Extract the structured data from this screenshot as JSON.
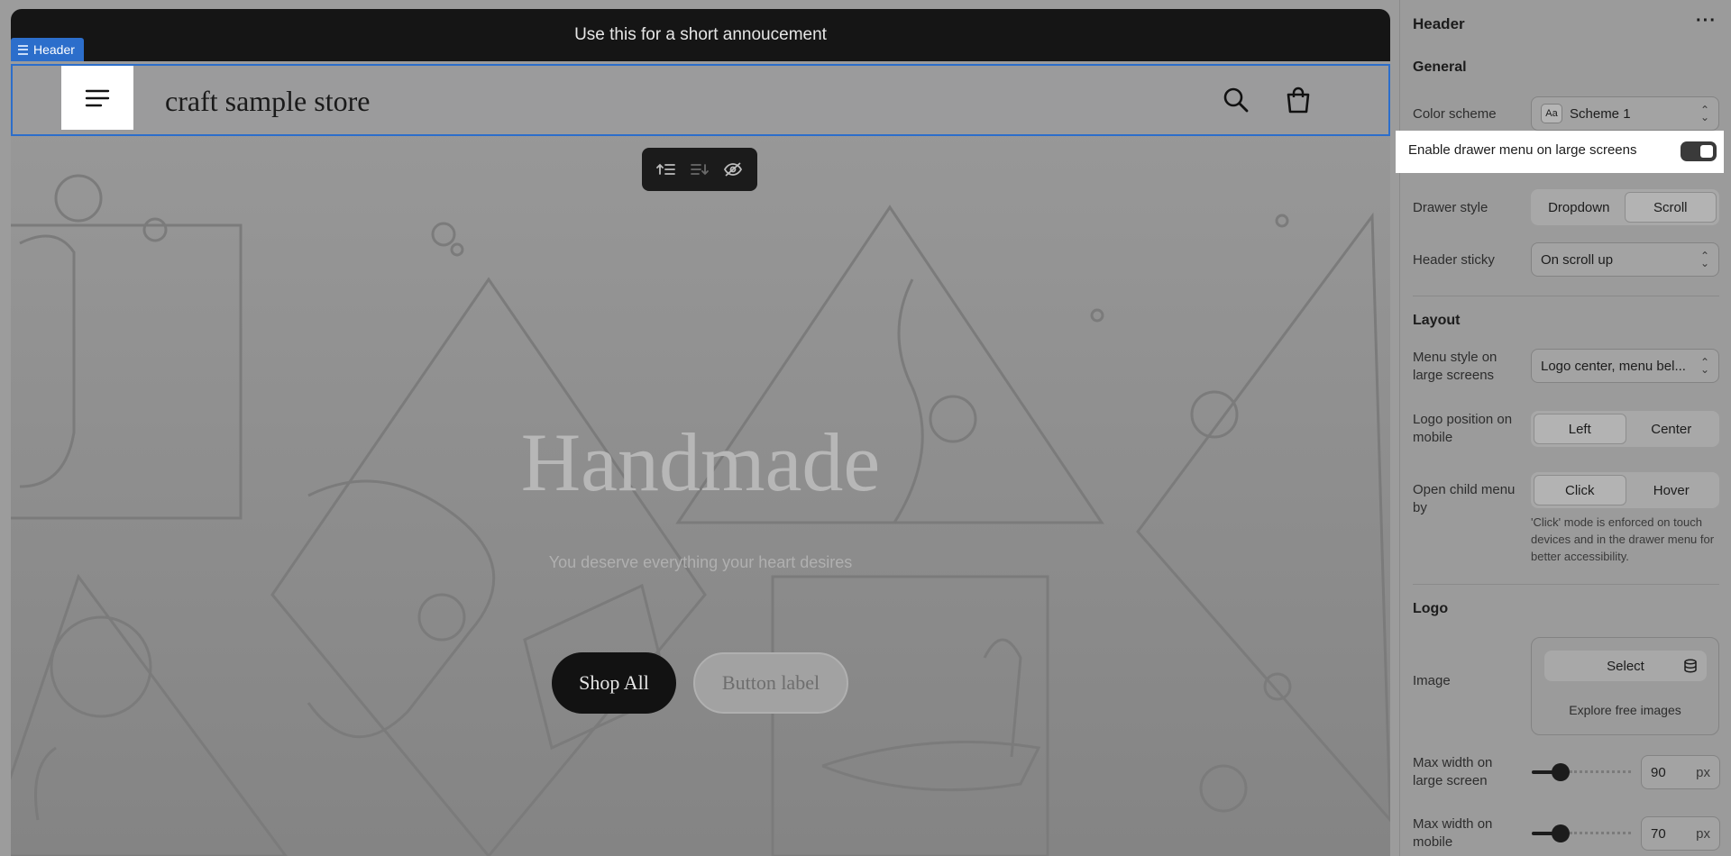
{
  "preview": {
    "announcement": "Use this for a short annoucement",
    "header_tag": "Header",
    "store_name": "craft sample store",
    "icons": {
      "menu": "hamburger-menu-icon",
      "search": "search-icon",
      "cart": "shopping-bag-icon"
    },
    "toolbar": {
      "move_up": "move-up-icon",
      "move_down": "move-down-icon",
      "hide": "hide-eye-icon"
    },
    "hero": {
      "heading": "Handmade",
      "subheading": "You deserve everything your heart desires",
      "primary_button": "Shop All",
      "secondary_button": "Button label"
    }
  },
  "panel": {
    "title": "Header",
    "more": "···",
    "general": {
      "title": "General",
      "color_scheme_label": "Color scheme",
      "color_scheme_value": "Scheme 1",
      "color_scheme_swatch": "Aa",
      "drawer_toggle_label": "Enable drawer menu on large screens",
      "drawer_toggle_on": true,
      "drawer_style_label": "Drawer style",
      "drawer_style_options": [
        "Dropdown",
        "Scroll"
      ],
      "drawer_style_selected": "Scroll",
      "header_sticky_label": "Header sticky",
      "header_sticky_value": "On scroll up"
    },
    "layout": {
      "title": "Layout",
      "menu_style_label": "Menu style on large screens",
      "menu_style_value": "Logo center, menu bel...",
      "logo_position_label": "Logo position on mobile",
      "logo_position_options": [
        "Left",
        "Center"
      ],
      "logo_position_selected": "Left",
      "child_menu_label": "Open child menu by",
      "child_menu_options": [
        "Click",
        "Hover"
      ],
      "child_menu_selected": "Click",
      "child_menu_note": "'Click' mode is enforced on touch devices and in the drawer menu for better accessibility."
    },
    "logo": {
      "title": "Logo",
      "image_label": "Image",
      "select_button": "Select",
      "explore_link": "Explore free images",
      "max_width_large_label": "Max width on large screen",
      "max_width_large_value": "90",
      "max_width_mobile_label": "Max width on mobile",
      "max_width_mobile_value": "70",
      "unit": "px",
      "slider_fraction_large": 0.29,
      "slider_fraction_mobile": 0.29
    }
  },
  "colors": {
    "highlight": "#2c6ecb",
    "overlay_bg": "#9b9b9b",
    "dark": "#151515"
  }
}
